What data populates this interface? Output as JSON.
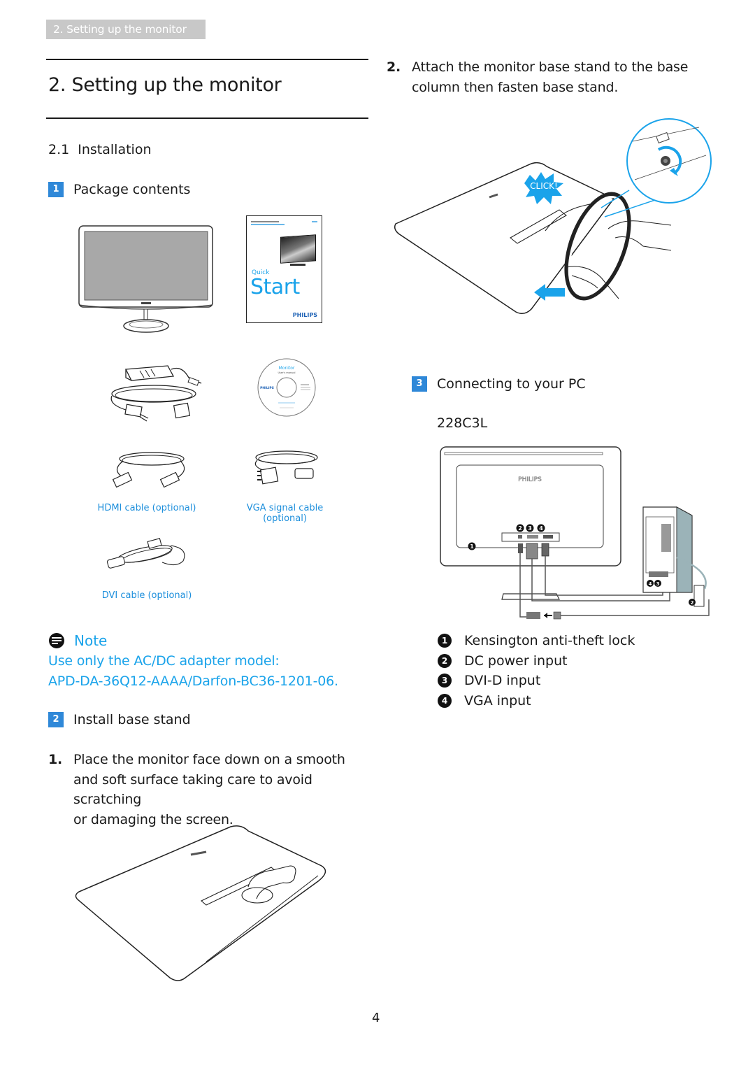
{
  "header": {
    "tab_label": "2. Setting up the monitor"
  },
  "title": "2.  Setting up the monitor",
  "section": {
    "number": "2.1",
    "label": "Installation"
  },
  "steps": [
    {
      "badge": "1",
      "label": "Package contents"
    },
    {
      "badge": "2",
      "label": "Install base stand"
    },
    {
      "badge": "3",
      "label": "Connecting to your PC"
    }
  ],
  "package_contents": {
    "quickstart": {
      "quick": "Quick",
      "start": "Start",
      "brand": "PHILIPS"
    },
    "cd": {
      "title": "Monitor",
      "subtitle": "User's manual",
      "brand": "PHILIPS"
    },
    "captions": {
      "hdmi": "HDMI cable (optional)",
      "vga": "VGA signal cable (optional)",
      "dvi": "DVI cable (optional)"
    }
  },
  "note": {
    "title": "Note",
    "line1": "Use only the AC/DC adapter model:",
    "line2": "APD-DA-36Q12-AAAA/Darfon-BC36-1201-06."
  },
  "instructions": [
    {
      "num": "1.",
      "lines": [
        "Place the monitor face down on a smooth",
        "and soft surface taking care to avoid scratching",
        "or damaging the screen."
      ]
    },
    {
      "num": "2.",
      "lines": [
        "Attach the monitor base stand to the base",
        "column then fasten base stand."
      ]
    }
  ],
  "click_label": "CLICK!",
  "model": "228C3L",
  "monitor_brand": "PHILIPS",
  "connectors": [
    {
      "num": "1",
      "label": "Kensington anti-theft lock"
    },
    {
      "num": "2",
      "label": "DC power input"
    },
    {
      "num": "3",
      "label": "DVI-D input"
    },
    {
      "num": "4",
      "label": "VGA input"
    }
  ],
  "colors": {
    "accent_blue": "#1aa3ea",
    "badge_blue": "#2f88d8",
    "header_tab_gray": "#c8c8c8"
  },
  "page_number": "4"
}
